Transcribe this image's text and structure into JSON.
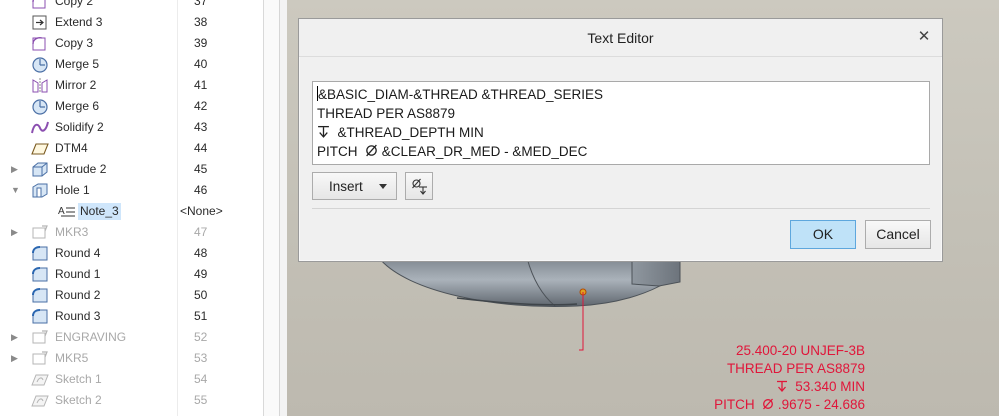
{
  "model_tree": {
    "rows": [
      {
        "label": "Copy 2",
        "number": "37",
        "icon": "copy-feature-icon",
        "expandable": false,
        "dim": false
      },
      {
        "label": "Extend 3",
        "number": "38",
        "icon": "extend-feature-icon",
        "expandable": false,
        "dim": false
      },
      {
        "label": "Copy 3",
        "number": "39",
        "icon": "copy-feature-icon",
        "expandable": false,
        "dim": false
      },
      {
        "label": "Merge 5",
        "number": "40",
        "icon": "merge-feature-icon",
        "expandable": false,
        "dim": false
      },
      {
        "label": "Mirror 2",
        "number": "41",
        "icon": "mirror-feature-icon",
        "expandable": false,
        "dim": false
      },
      {
        "label": "Merge 6",
        "number": "42",
        "icon": "merge-feature-icon",
        "expandable": false,
        "dim": false
      },
      {
        "label": "Solidify 2",
        "number": "43",
        "icon": "solidify-feature-icon",
        "expandable": false,
        "dim": false
      },
      {
        "label": "DTM4",
        "number": "44",
        "icon": "datum-plane-icon",
        "expandable": false,
        "dim": false
      },
      {
        "label": "Extrude 2",
        "number": "45",
        "icon": "extrude-feature-icon",
        "expandable": true,
        "dim": false
      },
      {
        "label": "Hole 1",
        "number": "46",
        "icon": "hole-feature-icon",
        "expandable": true,
        "expanded": true,
        "dim": false
      },
      {
        "label": "Note_3",
        "number": "<None>",
        "icon": "note-icon",
        "expandable": false,
        "child": true,
        "selected": true,
        "dim": false
      },
      {
        "label": "MKR3",
        "number": "47",
        "icon": "marker-feature-icon",
        "expandable": true,
        "dim": true
      },
      {
        "label": "Round 4",
        "number": "48",
        "icon": "round-feature-icon",
        "expandable": false,
        "dim": false
      },
      {
        "label": "Round 1",
        "number": "49",
        "icon": "round-feature-icon",
        "expandable": false,
        "dim": false
      },
      {
        "label": "Round 2",
        "number": "50",
        "icon": "round-feature-icon",
        "expandable": false,
        "dim": false
      },
      {
        "label": "Round 3",
        "number": "51",
        "icon": "round-feature-icon",
        "expandable": false,
        "dim": false
      },
      {
        "label": "ENGRAVING",
        "number": "52",
        "icon": "marker-feature-icon",
        "expandable": true,
        "dim": true
      },
      {
        "label": "MKR5",
        "number": "53",
        "icon": "marker-feature-icon",
        "expandable": true,
        "dim": true
      },
      {
        "label": "Sketch 1",
        "number": "54",
        "icon": "sketch-feature-icon",
        "expandable": false,
        "dim": true
      },
      {
        "label": "Sketch 2",
        "number": "55",
        "icon": "sketch-feature-icon",
        "expandable": false,
        "dim": true
      }
    ]
  },
  "dialog": {
    "title": "Text Editor",
    "close_icon": "close-icon",
    "editor_lines": [
      "&BASIC_DIAM-&THREAD &THREAD_SERIES",
      "THREAD PER AS8879",
      "&THREAD_DEPTH MIN",
      "&CLEAR_DR_MED - &MED_DEC"
    ],
    "editor_line_prefixes": [
      "",
      "",
      "depth-symbol",
      "PITCH "
    ],
    "pitch_prefix": "PITCH",
    "insert_label": "Insert",
    "symbol_button_icon": "symbol-palette-icon",
    "ok_label": "OK",
    "cancel_label": "Cancel"
  },
  "annotation": {
    "line1": "25.400-20 UNJEF-3B",
    "line2": "THREAD PER AS8879",
    "line3": "53.340 MIN",
    "line4_prefix": "PITCH",
    "line4": ".9675 - 24.686",
    "color": "#e0163a"
  },
  "colors": {
    "selection": "#cfe6fb",
    "ok_button": "#bfe2f8",
    "viewport_bg": "#c6c3b9"
  }
}
